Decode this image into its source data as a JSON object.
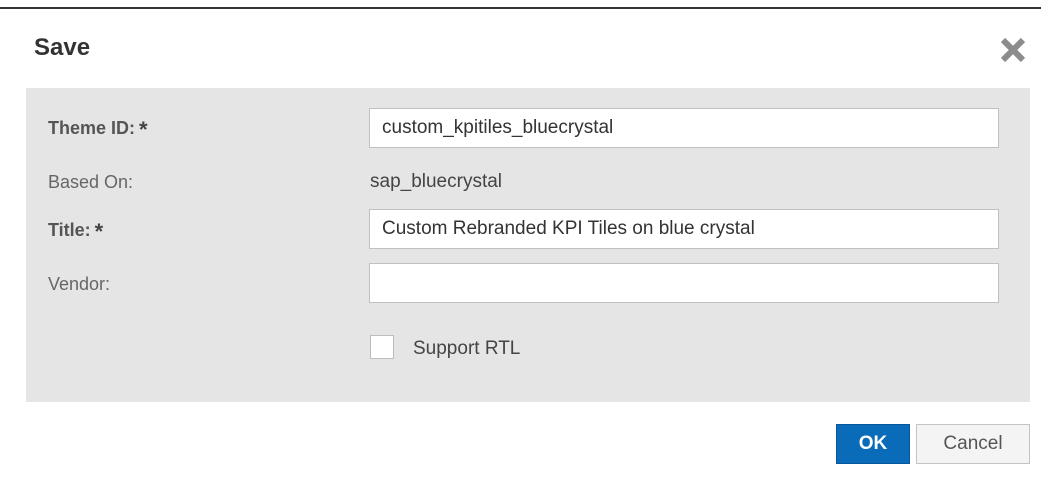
{
  "dialog": {
    "title": "Save",
    "close_icon": "close-icon"
  },
  "form": {
    "theme_id": {
      "label": "Theme ID:",
      "required_mark": "*",
      "value": "custom_kpitiles_bluecrystal"
    },
    "based_on": {
      "label": "Based On:",
      "value": "sap_bluecrystal"
    },
    "title": {
      "label": "Title:",
      "required_mark": "*",
      "value": "Custom Rebranded KPI Tiles on blue crystal"
    },
    "vendor": {
      "label": "Vendor:",
      "value": ""
    },
    "support_rtl": {
      "label": "Support RTL",
      "checked": false
    }
  },
  "footer": {
    "ok_label": "OK",
    "cancel_label": "Cancel"
  },
  "colors": {
    "primary_button": "#0a6bb8",
    "form_background": "#e5e5e5"
  }
}
